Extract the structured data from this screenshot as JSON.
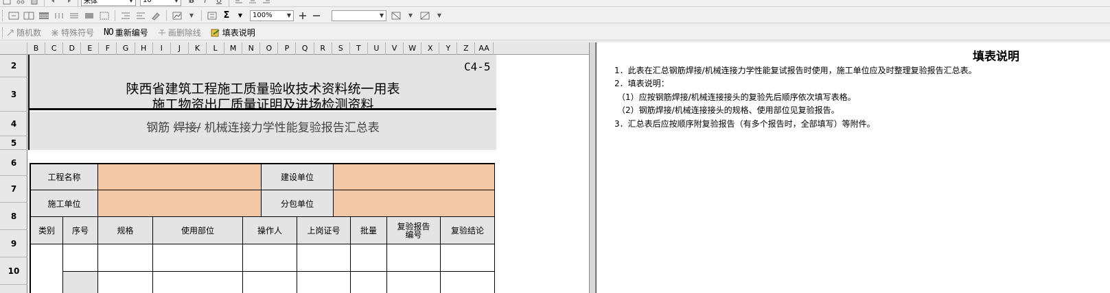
{
  "toolbar": {
    "font_name": "宋体",
    "font_size": "10",
    "zoom": "100%",
    "line_style": ""
  },
  "toolbar3": {
    "random_number": "随机数",
    "special_symbol": "特殊符号",
    "renumber_prefix": "NO",
    "renumber": "重新编号",
    "strikethrough": "画删除线",
    "fill_instructions": "填表说明"
  },
  "columns": [
    "B",
    "C",
    "D",
    "E",
    "F",
    "G",
    "H",
    "I",
    "J",
    "K",
    "L",
    "M",
    "N",
    "O",
    "P",
    "Q",
    "R",
    "S",
    "T",
    "U",
    "V",
    "W",
    "X",
    "Y",
    "Z",
    "AA"
  ],
  "rows": [
    "2",
    "3",
    "4",
    "5",
    "6",
    "7",
    "8",
    "9",
    "10"
  ],
  "form": {
    "code": "C4-5",
    "title_line1": "陕西省建筑工程施工质量验收技术资料统一用表",
    "title_line2": "施工物资出厂质量证明及进场检测资料",
    "subtitle_pre": "钢筋",
    "subtitle_struck": "焊接/",
    "subtitle_post": "机械连接力学性能复验报告汇总表",
    "project_name_label": "工程名称",
    "construction_unit_label": "建设单位",
    "builder_unit_label": "施工单位",
    "subcontract_unit_label": "分包单位",
    "headers": {
      "category": "类别",
      "seq": "序号",
      "spec": "规格",
      "usage_part": "使用部位",
      "operator": "操作人",
      "cert_no": "上岗证号",
      "batch": "批量",
      "report_no": "复验报告编号",
      "conclusion": "复验结论"
    }
  },
  "notes": {
    "title": "填表说明",
    "lines": [
      "1．此表在汇总钢筋焊接/机械连接力学性能复试报告时使用，施工单位应及时整理复验报告汇总表。",
      "2．填表说明：",
      "（1）应按钢筋焊接/机械连接接头的复验先后顺序依次填写表格。",
      "（2）钢筋焊接/机械连接接头的规格、使用部位见复验报告。",
      "3．汇总表后应按顺序附复验报告（有多个报告时，全部填写）等附件。"
    ]
  },
  "colors": {
    "input_fill": "#f2c7a5",
    "band_gray": "#e4e4e4"
  }
}
